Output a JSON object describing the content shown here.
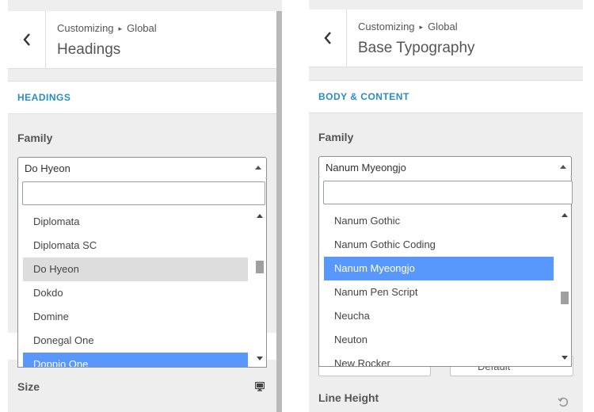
{
  "left_panel": {
    "breadcrumb": {
      "root": "Customizing",
      "current": "Global"
    },
    "title": "Headings",
    "section_title": "HEADINGS",
    "family_label": "Family",
    "selected_value": "Do Hyeon",
    "search_value": "",
    "options": [
      {
        "label": "Diplomata",
        "state": ""
      },
      {
        "label": "Diplomata SC",
        "state": ""
      },
      {
        "label": "Do Hyeon",
        "state": "hover"
      },
      {
        "label": "Dokdo",
        "state": ""
      },
      {
        "label": "Domine",
        "state": ""
      },
      {
        "label": "Donegal One",
        "state": ""
      },
      {
        "label": "Doppio One",
        "state": "selected"
      }
    ],
    "scroll_position": 0.33,
    "size_label": "Size",
    "size_icon": "monitor-icon"
  },
  "right_panel": {
    "breadcrumb": {
      "root": "Customizing",
      "current": "Global"
    },
    "title": "Base Typography",
    "section_title": "BODY & CONTENT",
    "family_label": "Family",
    "selected_value": "Nanum Myeongjo",
    "search_value": "",
    "options": [
      {
        "label": "Nanum Gothic",
        "state": ""
      },
      {
        "label": "Nanum Gothic Coding",
        "state": ""
      },
      {
        "label": "Nanum Myeongjo",
        "state": "selected"
      },
      {
        "label": "Nanum Pen Script",
        "state": ""
      },
      {
        "label": "Neucha",
        "state": ""
      },
      {
        "label": "Neuton",
        "state": ""
      },
      {
        "label": "New Rocker",
        "state": ""
      }
    ],
    "scroll_position": 0.6,
    "behind_field_right": "Default",
    "line_height_label": "Line Height",
    "reset_icon": "reset-icon"
  },
  "colors": {
    "accent": "#2a8cc7",
    "selected_option": "#5897fb",
    "hover_option": "#dddddd",
    "panel_bg": "#eeeeee"
  }
}
